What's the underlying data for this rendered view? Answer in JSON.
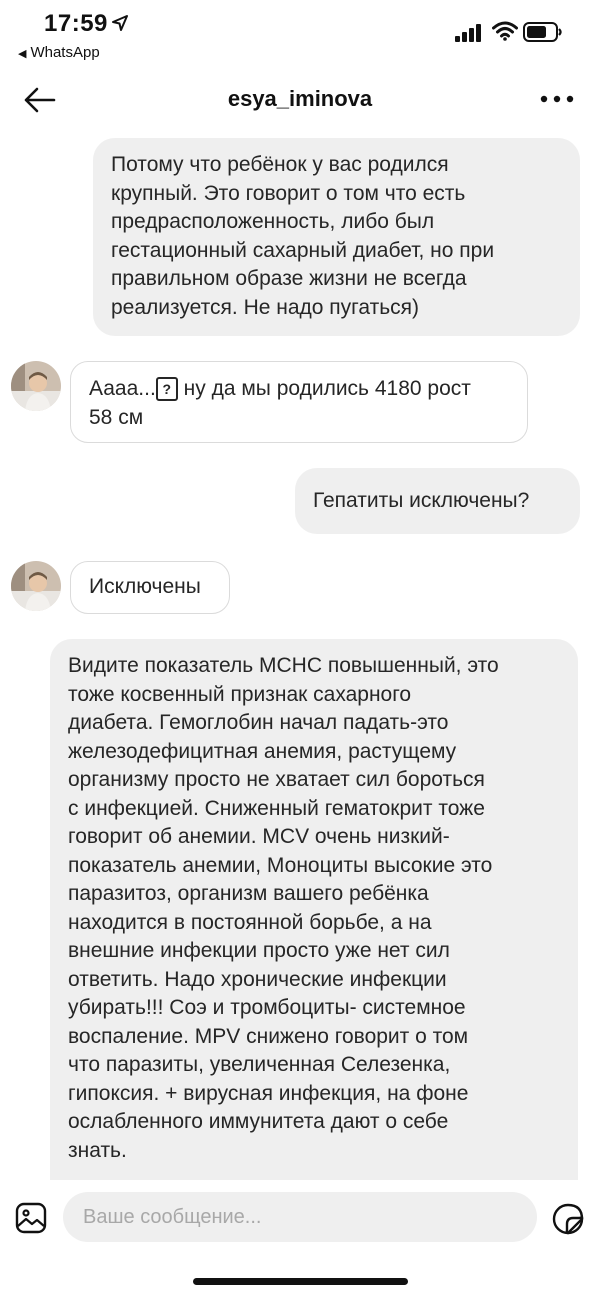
{
  "status_bar": {
    "time": "17:59",
    "back_app": "WhatsApp"
  },
  "header": {
    "contact_name": "esya_iminova"
  },
  "messages": [
    {
      "direction": "outgoing",
      "lines": [
        "Потому что ребёнок у вас родился",
        "крупный. Это говорит о том что есть",
        "предрасположенность, либо был",
        "гестационный сахарный диабет, но при",
        "правильном образе жизни не всегда",
        "реализуется. Не надо пугаться)"
      ]
    },
    {
      "direction": "incoming",
      "prefix": "Аааа...",
      "emoji_placeholder": "?",
      "line1_rest": " ну да мы родились 4180 рост",
      "line2": "58 см"
    },
    {
      "direction": "outgoing",
      "text": "Гепатиты исключены?"
    },
    {
      "direction": "incoming",
      "text": "Исключены"
    },
    {
      "direction": "incoming",
      "lines": [
        "Видите показатель МСНС повышенный, это",
        "тоже косвенный признак сахарного",
        "диабета. Гемоглобин начал падать-это",
        "железодефицитная анемия, растущему",
        "организму просто не хватает сил бороться",
        "с инфекцией. Сниженный гематокрит тоже",
        "говорит об анемии. MCV очень низкий-",
        "показатель анемии, Моноциты высокие это",
        "паразитоз, организм вашего ребёнка",
        "находится в постоянной борьбе, а на",
        "внешние инфекции просто уже нет сил",
        "ответить. Надо хронические инфекции",
        "убирать!!! Соэ и тромбоциты- системное",
        "воспаление. MPV снижено говорит о том",
        "что паразиты, увеличенная Селезенка,",
        "гипоксия. + вирусная инфекция, на фоне",
        "ослабленного иммунитета дают о себе",
        "знать."
      ]
    }
  ],
  "composer": {
    "placeholder": "Ваше сообщение..."
  },
  "icons": {
    "back": "arrow-left-icon",
    "more": "more-horizontal-icon",
    "gallery": "image-icon",
    "sticker": "sticker-icon"
  },
  "colors": {
    "outgoing_bubble": "#efefef",
    "incoming_border": "#dbdbdb",
    "background": "#ffffff"
  }
}
